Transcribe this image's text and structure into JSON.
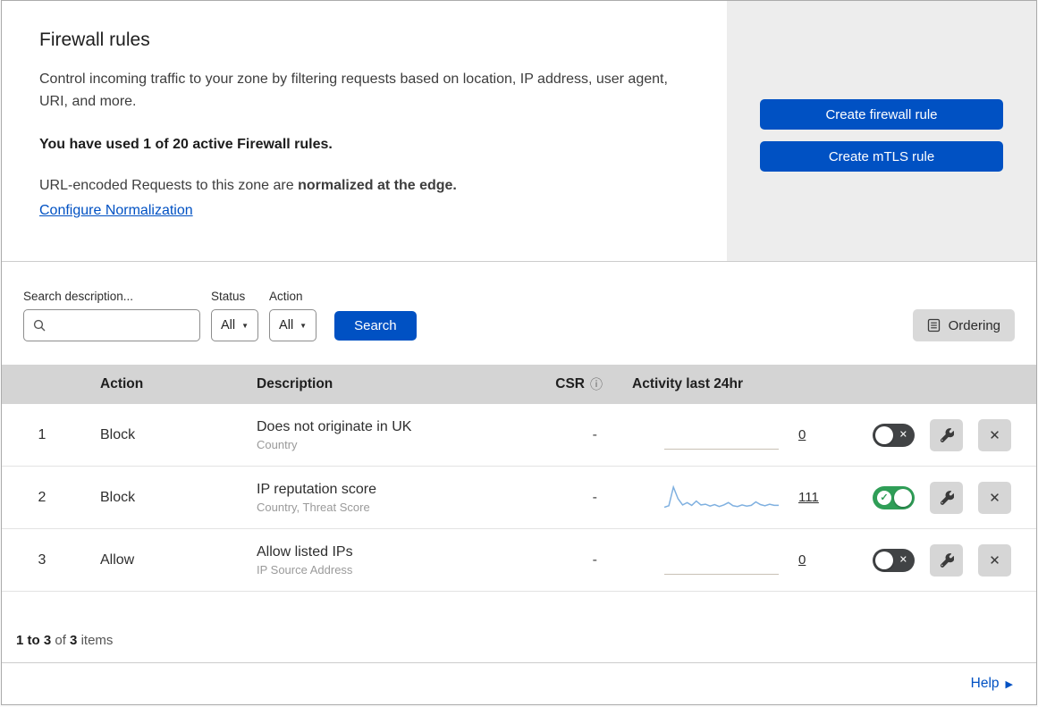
{
  "header": {
    "title": "Firewall rules",
    "description": "Control incoming traffic to your zone by filtering requests based on location, IP address, user agent, URI, and more.",
    "usage": "You have used 1 of 20 active Firewall rules.",
    "normalization_prefix": "URL-encoded Requests to this zone are ",
    "normalization_bold": "normalized at the edge.",
    "normalization_link": "Configure Normalization",
    "buttons": [
      {
        "label": "Create firewall rule"
      },
      {
        "label": "Create mTLS rule"
      }
    ]
  },
  "filters": {
    "search_label": "Search description...",
    "search_value": "",
    "status_label": "Status",
    "status_value": "All",
    "action_label": "Action",
    "action_value": "All",
    "search_button": "Search",
    "ordering_button": "Ordering"
  },
  "table": {
    "headers": {
      "action": "Action",
      "description": "Description",
      "csr": "CSR",
      "activity": "Activity last 24hr"
    },
    "rows": [
      {
        "priority": "1",
        "action": "Block",
        "description": "Does not originate in UK",
        "fields": "Country",
        "csr": "-",
        "activity": "0",
        "enabled": false,
        "sparkline": []
      },
      {
        "priority": "2",
        "action": "Block",
        "description": "IP reputation score",
        "fields": "Country, Threat Score",
        "csr": "-",
        "activity": "111",
        "enabled": true,
        "sparkline": [
          8,
          12,
          60,
          30,
          14,
          20,
          13,
          24,
          14,
          16,
          11,
          15,
          10,
          14,
          20,
          12,
          10,
          14,
          11,
          13,
          22,
          15,
          12,
          16,
          13,
          13
        ]
      },
      {
        "priority": "3",
        "action": "Allow",
        "description": "Allow listed IPs",
        "fields": "IP Source Address",
        "csr": "-",
        "activity": "0",
        "enabled": false,
        "sparkline": []
      }
    ],
    "footer": {
      "range": "1 to 3",
      "of": "of",
      "total": "3",
      "items": "items"
    }
  },
  "help": {
    "label": "Help"
  },
  "icons": {
    "caret": "▼",
    "info": "ⓘ",
    "check": "✓",
    "x": "✕",
    "close": "✕",
    "help_arrow": "▶"
  },
  "colors": {
    "accent_blue": "#0051c3",
    "toggle_on_green": "#2f9e57",
    "toggle_off_gray": "#414345",
    "header_panel_gray": "#ededed",
    "table_header_gray": "#d4d4d4",
    "sparkline_blue": "#7fb0e0"
  }
}
